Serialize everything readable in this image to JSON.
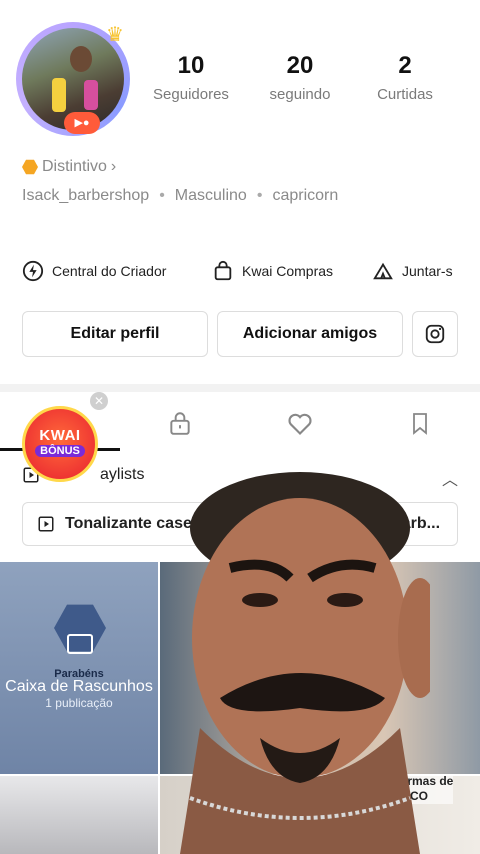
{
  "profile": {
    "stats": [
      {
        "value": "10",
        "label": "Seguidores"
      },
      {
        "value": "20",
        "label": "seguindo"
      },
      {
        "value": "2",
        "label": "Curtidas"
      }
    ],
    "distintivo": "Distintivo",
    "username": "Isack_barbershop",
    "gender": "Masculino",
    "sign": "capricorn"
  },
  "quick_links": {
    "creator": "Central do Criador",
    "shop": "Kwai Compras",
    "join": "Juntar-s"
  },
  "actions": {
    "edit": "Editar perfil",
    "add": "Adicionar amigos"
  },
  "bonus": {
    "line1": "KWAI",
    "line2": "BÔNUS"
  },
  "playlists": {
    "header": "Playlists",
    "header_visible": "aylists",
    "item": "Tonalizante casei",
    "item_tail": "barb..."
  },
  "drafts": {
    "tag": "Parabéns",
    "title": "Caixa de Rascunhos",
    "count": "1 publicação"
  },
  "tile_caption": {
    "line1": "5 formas de",
    "line2": "R RICO"
  },
  "colors": {
    "accent": "#f5a623",
    "bonus": "#e8202f"
  }
}
